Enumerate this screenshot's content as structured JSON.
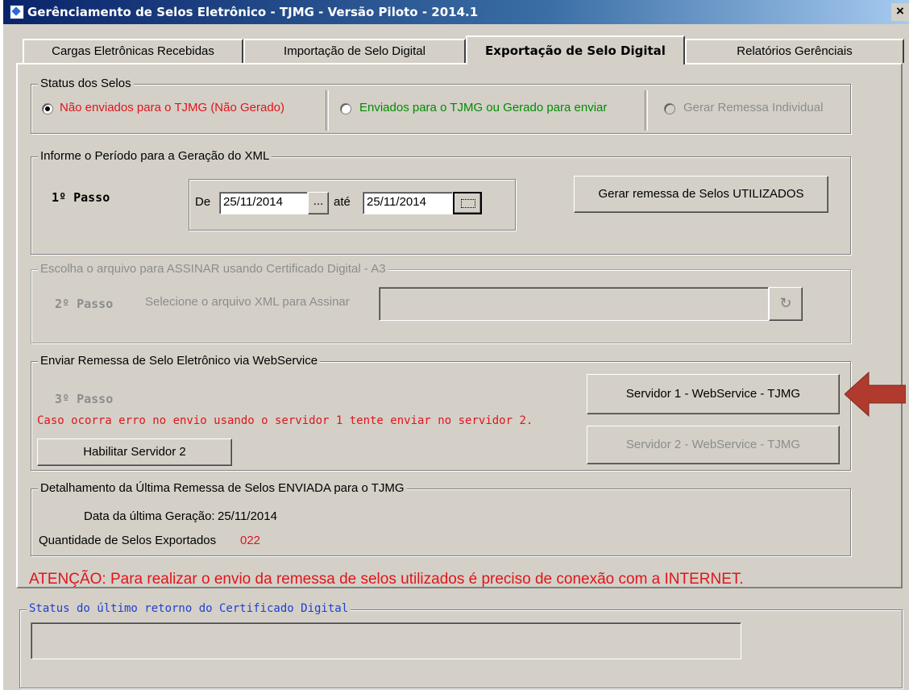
{
  "window": {
    "title": "Gerênciamento de Selos Eletrônico - TJMG  - Versão Piloto - 2014.1",
    "close": "×"
  },
  "tabs": [
    {
      "label": "Cargas Eletrônicas Recebidas"
    },
    {
      "label": "Importação de Selo Digital"
    },
    {
      "label": "Exportação de Selo Digital"
    },
    {
      "label": "Relatórios Gerênciais"
    }
  ],
  "status_group": {
    "legend": "Status dos Selos",
    "options": [
      {
        "label": "Não enviados para o TJMG (Não Gerado)",
        "color": "#e0151b",
        "checked": true
      },
      {
        "label": "Enviados para o TJMG  ou Gerado para enviar",
        "color": "#008c00",
        "checked": false
      },
      {
        "label": "Gerar Remessa Individual",
        "color": "#8c8c8c",
        "checked": false
      }
    ]
  },
  "periodo_group": {
    "legend": "Informe o Período para a Geração do XML",
    "step": "1º Passo",
    "de_label": "De",
    "de_value": "25/11/2014",
    "ate_label": "até",
    "ate_value": "25/11/2014",
    "browse_label": "...",
    "generate_button": "Gerar remessa de Selos UTILIZADOS"
  },
  "assinar_group": {
    "legend": "Escolha o arquivo para ASSINAR usando Certificado Digital - A3",
    "step": "2º Passo",
    "label": "Selecione o arquivo XML para Assinar",
    "value": ""
  },
  "enviar_group": {
    "legend": "Enviar Remessa de Selo Eletrônico via WebService",
    "step": "3º Passo",
    "warning": "Caso ocorra erro no envio usando o servidor 1 tente enviar no servidor 2.",
    "enable_button": "Habilitar Servidor 2",
    "server1_button": "Servidor 1 - WebService - TJMG",
    "server2_button": "Servidor 2  - WebService - TJMG"
  },
  "detalhamento_group": {
    "legend": "Detalhamento da Última  Remessa de Selos  ENVIADA para o  TJMG",
    "data_label": "Data da última  Geração:",
    "data_value": "25/11/2014",
    "qtd_label": "Quantidade de Selos Exportados",
    "qtd_value": "022"
  },
  "attention": "ATENÇÃO: Para realizar o envio da remessa de selos utilizados é preciso de conexão com a INTERNET.",
  "certificado_group": {
    "legend": "Status do último retorno do Certificado Digital",
    "value": ""
  },
  "colors": {
    "accent_red": "#e0151b",
    "green": "#008c00",
    "arrow": "#b03a2e"
  }
}
